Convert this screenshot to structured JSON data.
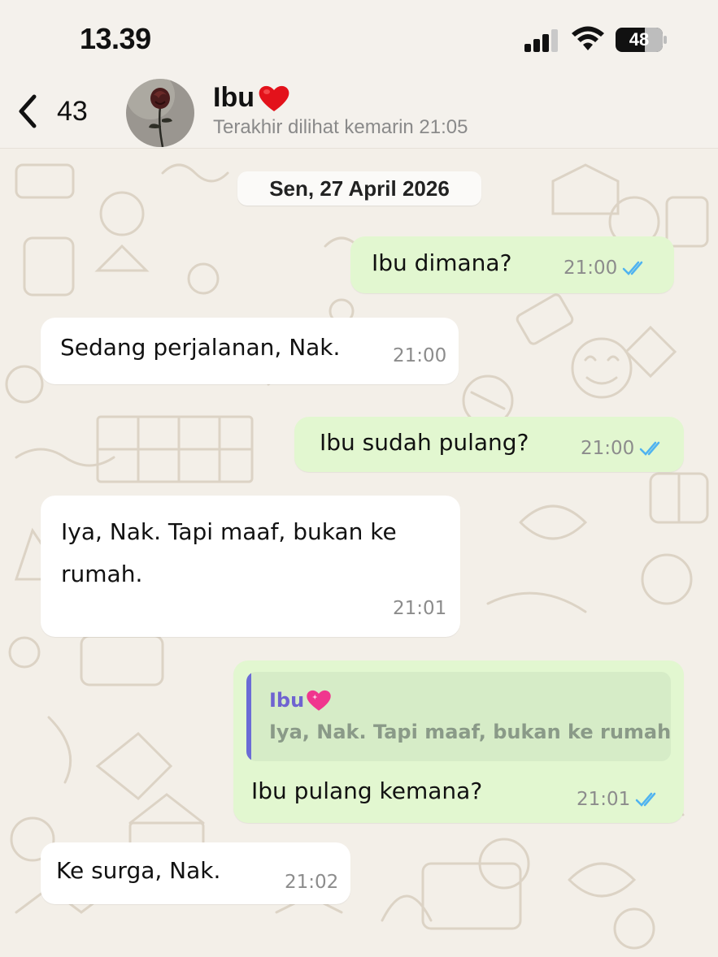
{
  "status_bar": {
    "time": "13.39",
    "battery_level": "48",
    "icons": [
      "signal-icon",
      "wifi-icon",
      "battery-icon"
    ]
  },
  "header": {
    "back_count": "43",
    "contact_name": "Ibu",
    "contact_emoji": "red-heart-icon",
    "last_seen": "Terakhir dilihat kemarin 21:05",
    "avatar": "rose-avatar"
  },
  "chat": {
    "date": "Sen, 27 April 2026",
    "messages": [
      {
        "direction": "out",
        "text": "Ibu dimana?",
        "time": "21:00",
        "status": "read"
      },
      {
        "direction": "in",
        "text": "Sedang perjalanan, Nak.",
        "time": "21:00"
      },
      {
        "direction": "out",
        "text": "Ibu sudah pulang?",
        "time": "21:00",
        "status": "read"
      },
      {
        "direction": "in",
        "text_line1": "Iya, Nak. Tapi maaf, bukan ke",
        "text_line2": "rumah.",
        "time": "21:01"
      },
      {
        "direction": "out",
        "quoted_name": "Ibu",
        "quoted_emoji": "pink-heart-icon",
        "quoted_text": "Iya, Nak. Tapi maaf, bukan ke rumah.",
        "text": "Ibu pulang kemana?",
        "time": "21:01",
        "status": "read"
      },
      {
        "direction": "in",
        "text": "Ke surga, Nak.",
        "time": "21:02"
      }
    ]
  },
  "colors": {
    "outgoing_bubble": "#e2f7d0",
    "incoming_bubble": "#ffffff",
    "read_ticks": "#4fb3f0",
    "quote_accent": "#6b6bd6",
    "wallpaper": "#f3efe8"
  }
}
